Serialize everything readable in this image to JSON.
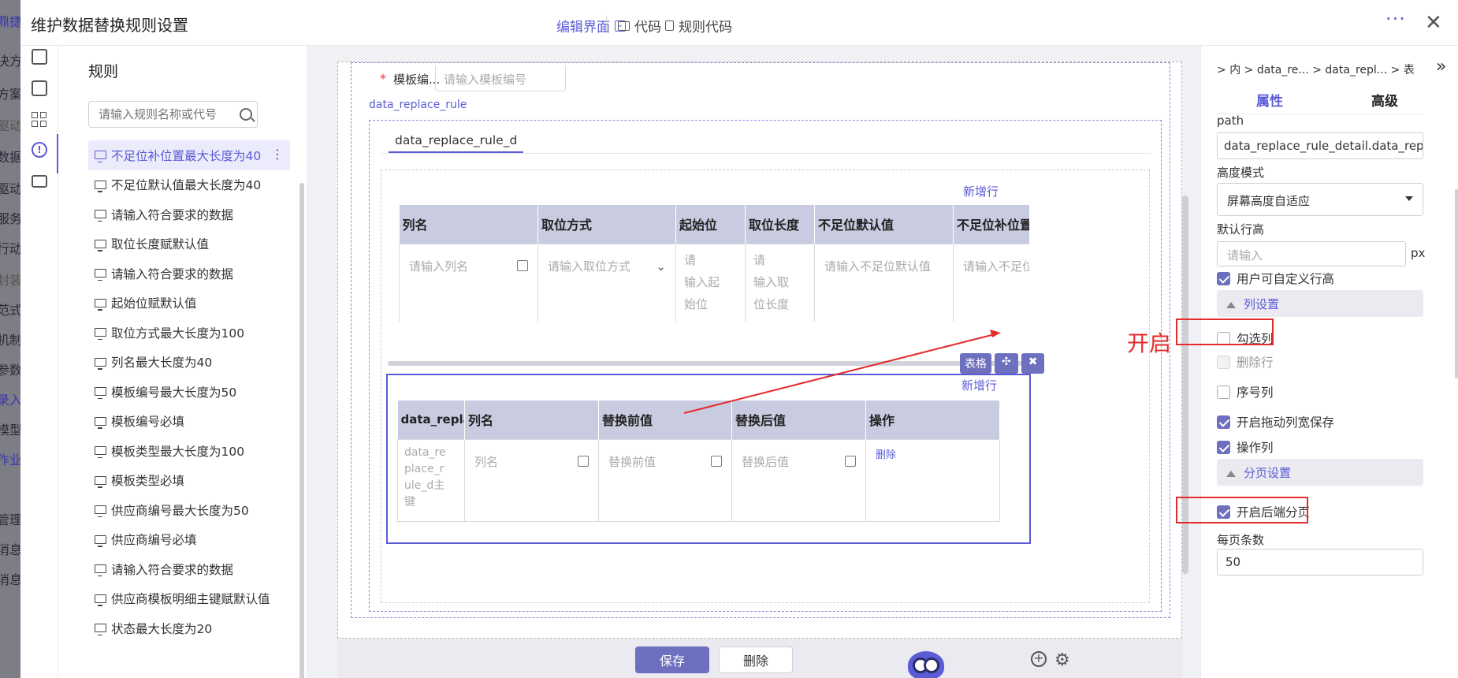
{
  "bg_partial_labels": [
    "鼎捷",
    "决方案",
    "方案",
    "驱动",
    "数据",
    "驱动",
    "服务",
    "行动",
    "封装",
    "范式",
    "机制",
    "参数",
    "录入",
    "模型",
    "作业",
    "管理",
    "消息",
    "消息"
  ],
  "dialog": {
    "title": "维护数据替换规则设置",
    "toolbar": {
      "edit_view": "编辑界面",
      "code": "代码",
      "rule_code": "规则代码"
    },
    "more": "···",
    "close": "✕"
  },
  "rule_panel": {
    "title": "规则",
    "search_placeholder": "请输入规则名称或代号",
    "rules": [
      "不足位补位置最大长度为40",
      "不足位默认值最大长度为40",
      "请输入符合要求的数据",
      "取位长度赋默认值",
      "请输入符合要求的数据",
      "起始位赋默认值",
      "取位方式最大长度为100",
      "列名最大长度为40",
      "模板编号最大长度为50",
      "模板编号必填",
      "模板类型最大长度为100",
      "模板类型必填",
      "供应商编号最大长度为50",
      "供应商编号必填",
      "请输入符合要求的数据",
      "供应商模板明细主键赋默认值",
      "状态最大长度为20"
    ],
    "selected_index": 0
  },
  "form": {
    "required_mark": "*",
    "template_code_label": "模板编...",
    "template_code_placeholder": "请输入模板编号",
    "rule_link": "data_replace_rule",
    "tab": "data_replace_rule_d",
    "add_row": "新增行",
    "table1": {
      "headers": [
        "列名",
        "取位方式",
        "起始位",
        "取位长度",
        "不足位默认值",
        "不足位补位置"
      ],
      "cells": [
        "请输入列名",
        "请输入取位方式",
        "请\n输入起\n始位",
        "请\n输入取\n位长度",
        "请输入不足位默认值",
        "请输入不足位补位置"
      ]
    },
    "badges": {
      "table": "表格",
      "move": "✣",
      "remove": "✖"
    },
    "table2": {
      "headers": [
        "data_repla...",
        "列名",
        "替换前值",
        "替换后值",
        "操作"
      ],
      "cells": [
        "data_re\nplace_r\nule_d主\n键",
        "列名",
        "替换前值",
        "替换后值",
        "删除"
      ]
    },
    "save": "保存",
    "delete": "删除"
  },
  "props": {
    "breadcrumb": [
      ">",
      "内",
      ">",
      "data_re...",
      ">",
      "data_repl...",
      ">",
      "表"
    ],
    "tabs": [
      "属性",
      "高级"
    ],
    "path_label": "path",
    "path_value": "data_replace_rule_detail.data_replace_ru",
    "height_mode_label": "高度模式",
    "height_mode_value": "屏幕高度自适应",
    "default_row_height_label": "默认行高",
    "default_row_height_placeholder": "请输入",
    "unit": "px",
    "custom_row_height": "用户可自定义行高",
    "col_settings": "列设置",
    "checkbox_col": "勾选列",
    "delete_row": "删除行",
    "serial_col": "序号列",
    "drag_save": "开启拖动列宽保存",
    "action_col": "操作列",
    "page_settings": "分页设置",
    "backend_paging": "开启后端分页",
    "page_size_label": "每页条数",
    "page_size_value": "50"
  },
  "annotation": {
    "text": "开启",
    "color": "#e52b2b"
  },
  "colors": {
    "accent": "#5b5bd6",
    "header_bg": "#c9cbe0",
    "button": "#6d6fbf"
  }
}
